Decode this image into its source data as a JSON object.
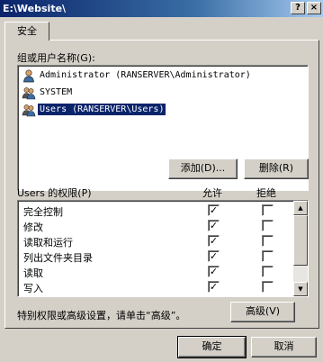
{
  "window": {
    "title": "E:\\Website\\",
    "help_label": "?",
    "close_label": "×"
  },
  "tabs": [
    {
      "label": "安全",
      "selected": true
    }
  ],
  "principals_label": "组或用户名称(G):",
  "principals": [
    {
      "name": "Administrator (RANSERVER\\Administrator)",
      "selected": false
    },
    {
      "name": "SYSTEM",
      "selected": false
    },
    {
      "name": "Users (RANSERVER\\Users)",
      "selected": true
    }
  ],
  "buttons": {
    "add": "添加(D)...",
    "remove": "删除(R)",
    "advanced": "高级(V)",
    "ok": "确定",
    "cancel": "取消"
  },
  "permissions": {
    "label": "Users 的权限(P)",
    "allow_header": "允许",
    "deny_header": "拒绝",
    "rows": [
      {
        "name": "完全控制",
        "allow": true,
        "deny": false
      },
      {
        "name": "修改",
        "allow": true,
        "deny": false
      },
      {
        "name": "读取和运行",
        "allow": true,
        "deny": false
      },
      {
        "name": "列出文件夹目录",
        "allow": true,
        "deny": false
      },
      {
        "name": "读取",
        "allow": true,
        "deny": false
      },
      {
        "name": "写入",
        "allow": true,
        "deny": false
      }
    ]
  },
  "advanced_hint": "特别权限或高级设置，请单击“高级”。",
  "icons": {
    "user": "user-icon",
    "users": "users-group-icon",
    "check": "✓",
    "scroll_up": "▲",
    "scroll_down": "▼"
  }
}
